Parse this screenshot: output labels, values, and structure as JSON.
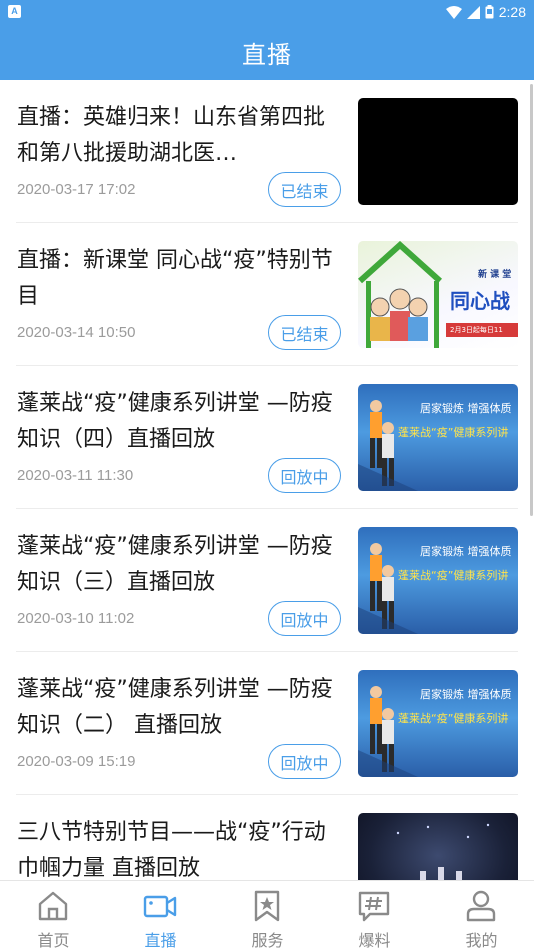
{
  "status_bar": {
    "time": "2:28",
    "app_badge": "A"
  },
  "header": {
    "title": "直播"
  },
  "items": [
    {
      "title": "直播：英雄归来！山东省第四批和第八批援助湖北医…",
      "date": "2020-03-17 17:02",
      "status": "已结束",
      "thumb_type": "black"
    },
    {
      "title": "直播：新课堂 同心战“疫”特别节目",
      "date": "2020-03-14 10:50",
      "status": "已结束",
      "thumb_type": "poster",
      "thumb_texts": [
        "新 课 堂",
        "同心战",
        "2月3日起每日11"
      ]
    },
    {
      "title": "蓬莱战“疫”健康系列讲堂 —防疫知识（四）直播回放",
      "date": "2020-03-11 11:30",
      "status": "回放中",
      "thumb_type": "exercise",
      "thumb_texts": [
        "居家锻炼  增强体质",
        "蓬莱战“疫”健康系列讲"
      ]
    },
    {
      "title": "蓬莱战“疫”健康系列讲堂 —防疫知识（三）直播回放",
      "date": "2020-03-10 11:02",
      "status": "回放中",
      "thumb_type": "exercise",
      "thumb_texts": [
        "居家锻炼  增强体质",
        "蓬莱战“疫”健康系列讲"
      ]
    },
    {
      "title": "蓬莱战“疫”健康系列讲堂 —防疫知识（二） 直播回放",
      "date": "2020-03-09 15:19",
      "status": "回放中",
      "thumb_type": "exercise",
      "thumb_texts": [
        "居家锻炼  增强体质",
        "蓬莱战“疫”健康系列讲"
      ]
    },
    {
      "title": "三八节特别节目——战“疫”行动 巾帼力量  直播回放",
      "date": "",
      "status": "",
      "thumb_type": "stage"
    }
  ],
  "tabs": [
    {
      "label": "首页",
      "icon": "home-icon",
      "active": false
    },
    {
      "label": "直播",
      "icon": "video-camera-icon",
      "active": true
    },
    {
      "label": "服务",
      "icon": "bookmark-star-icon",
      "active": false
    },
    {
      "label": "爆料",
      "icon": "hashtag-chat-icon",
      "active": false
    },
    {
      "label": "我的",
      "icon": "user-icon",
      "active": false
    }
  ],
  "colors": {
    "primary": "#4a9ee8",
    "text": "#1a1a1a",
    "muted": "#9b9b9b",
    "divider": "#ececec"
  }
}
